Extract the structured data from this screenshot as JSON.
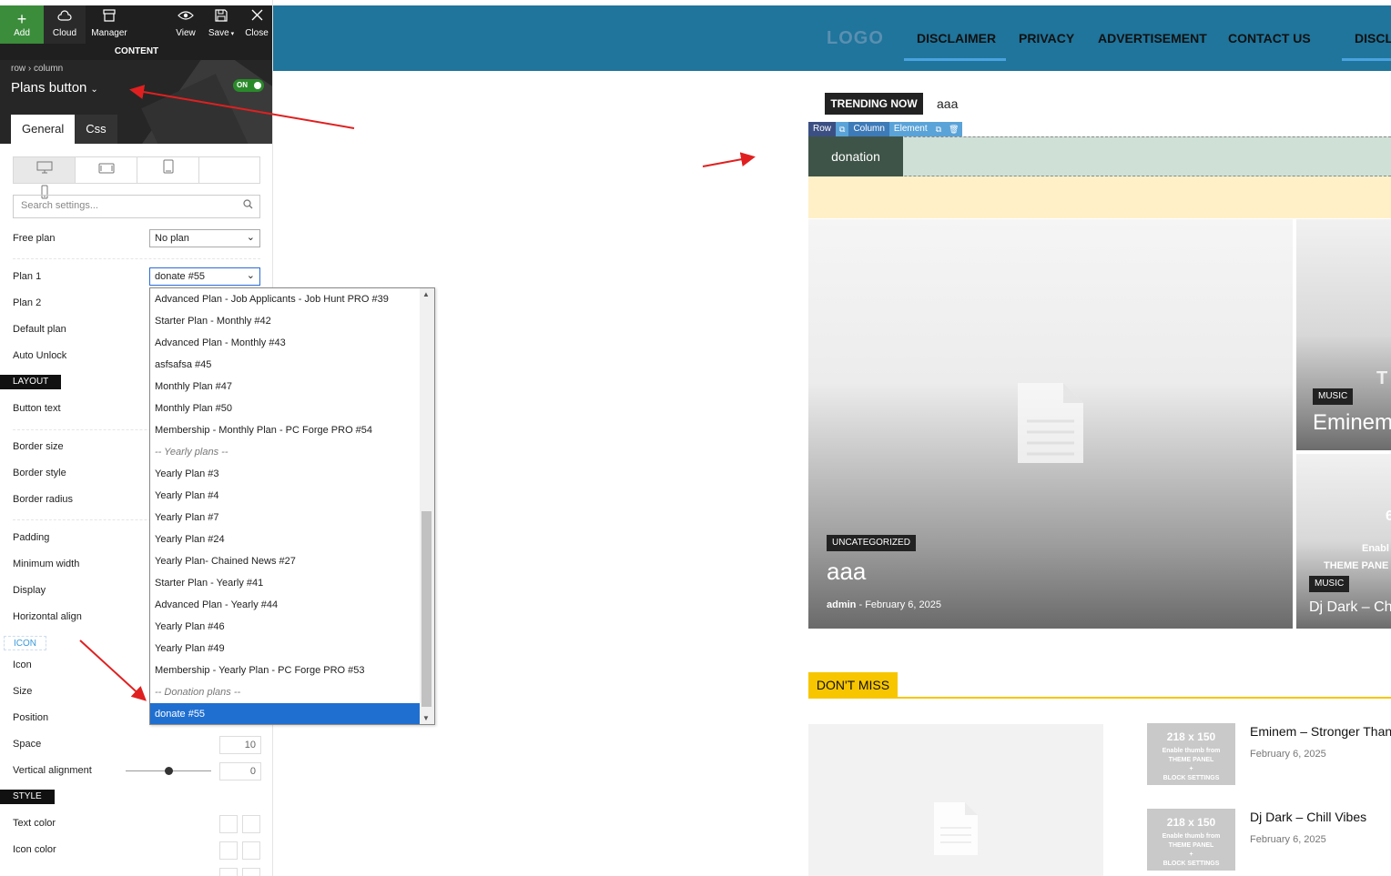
{
  "toolbar": {
    "add": "Add",
    "cloud": "Cloud",
    "manager": "Manager",
    "view": "View",
    "save": "Save",
    "close": "Close",
    "content_bar": "CONTENT"
  },
  "element": {
    "breadcrumb": "row › column",
    "title": "Plans button",
    "toggle": "ON"
  },
  "tabs": {
    "general": "General",
    "css": "Css"
  },
  "search": {
    "placeholder": "Search settings..."
  },
  "settings": {
    "free_plan_label": "Free plan",
    "free_plan_value": "No plan",
    "plan1_label": "Plan 1",
    "plan1_value": "donate #55",
    "plan2_label": "Plan 2",
    "default_plan_label": "Default plan",
    "auto_unlock_label": "Auto Unlock",
    "layout_section": "LAYOUT",
    "button_text_label": "Button text",
    "border_size_label": "Border size",
    "border_style_label": "Border style",
    "border_radius_label": "Border radius",
    "padding_label": "Padding",
    "min_width_label": "Minimum width",
    "display_label": "Display",
    "h_align_label": "Horizontal align",
    "icon_section": "ICON",
    "icon_label": "Icon",
    "size_label": "Size",
    "position_label": "Position",
    "space_label": "Space",
    "space_value": "10",
    "v_align_label": "Vertical alignment",
    "v_align_value": "0",
    "style_section": "STYLE",
    "text_color_label": "Text color",
    "icon_color_label": "Icon color"
  },
  "dropdown": {
    "options": [
      {
        "label": "Advanced Plan - Job Applicants - Job Hunt PRO #39",
        "type": "option"
      },
      {
        "label": "Starter Plan - Monthly #42",
        "type": "option"
      },
      {
        "label": "Advanced Plan - Monthly #43",
        "type": "option"
      },
      {
        "label": "asfsafsa #45",
        "type": "option"
      },
      {
        "label": "Monthly Plan #47",
        "type": "option"
      },
      {
        "label": "Monthly Plan #50",
        "type": "option"
      },
      {
        "label": "Membership - Monthly Plan - PC Forge PRO #54",
        "type": "option"
      },
      {
        "label": "-- Yearly plans --",
        "type": "group"
      },
      {
        "label": "Yearly Plan #3",
        "type": "option"
      },
      {
        "label": "Yearly Plan #4",
        "type": "option"
      },
      {
        "label": "Yearly Plan #7",
        "type": "option"
      },
      {
        "label": "Yearly Plan #24",
        "type": "option"
      },
      {
        "label": "Yearly Plan- Chained News #27",
        "type": "option"
      },
      {
        "label": "Starter Plan - Yearly #41",
        "type": "option"
      },
      {
        "label": "Advanced Plan - Yearly #44",
        "type": "option"
      },
      {
        "label": "Yearly Plan #46",
        "type": "option"
      },
      {
        "label": "Yearly Plan #49",
        "type": "option"
      },
      {
        "label": "Membership - Yearly Plan - PC Forge PRO #53",
        "type": "option"
      },
      {
        "label": "-- Donation plans --",
        "type": "group"
      },
      {
        "label": "donate #55",
        "type": "selected"
      }
    ]
  },
  "site": {
    "logo": "LOGO",
    "nav": [
      "DISCLAIMER",
      "PRIVACY",
      "ADVERTISEMENT",
      "CONTACT US",
      "DISCL"
    ],
    "trending_label": "TRENDING NOW",
    "trending_text": "aaa",
    "editor_tags": {
      "row": "Row",
      "column": "Column",
      "element": "Element"
    },
    "donation_button": "donation",
    "main_card": {
      "category": "UNCATEGORIZED",
      "title": "aaa",
      "author": "admin",
      "date": "February 6, 2025"
    },
    "side_card_1": {
      "category": "MUSIC",
      "title": "Eminem",
      "overlay": "T"
    },
    "side_card_2": {
      "category": "MUSIC",
      "title": "Dj Dark – Ch",
      "overlay1": "6",
      "overlay2": "Enabl",
      "overlay3": "THEME PANE"
    },
    "dont_miss": "DON'T MISS",
    "news": [
      {
        "title": "Eminem – Stronger Than",
        "date": "February 6, 2025"
      },
      {
        "title": "Dj Dark – Chill Vibes",
        "date": "February 6, 2025"
      }
    ],
    "thumb": {
      "size": "218 x 150",
      "l1": "Enable thumb from",
      "l2": "THEME PANEL",
      "l3": "+",
      "l4": "BLOCK SETTINGS"
    }
  },
  "colors": {
    "header_blue": "#1f759c",
    "accent_yellow": "#f7c600",
    "toggle_green": "#2a8a2a",
    "selected_option": "#1f6fd1",
    "donation_button": "#3f5449",
    "arrow_red": "#e02020"
  },
  "icons": {
    "add": "plus-icon",
    "cloud": "cloud-icon",
    "manager": "manager-icon",
    "view": "eye-icon",
    "save": "save-icon",
    "close": "close-icon",
    "search": "search-icon",
    "desktop": "desktop-icon",
    "tablet-landscape": "tablet-landscape-icon",
    "tablet": "tablet-icon",
    "mobile": "mobile-icon"
  }
}
